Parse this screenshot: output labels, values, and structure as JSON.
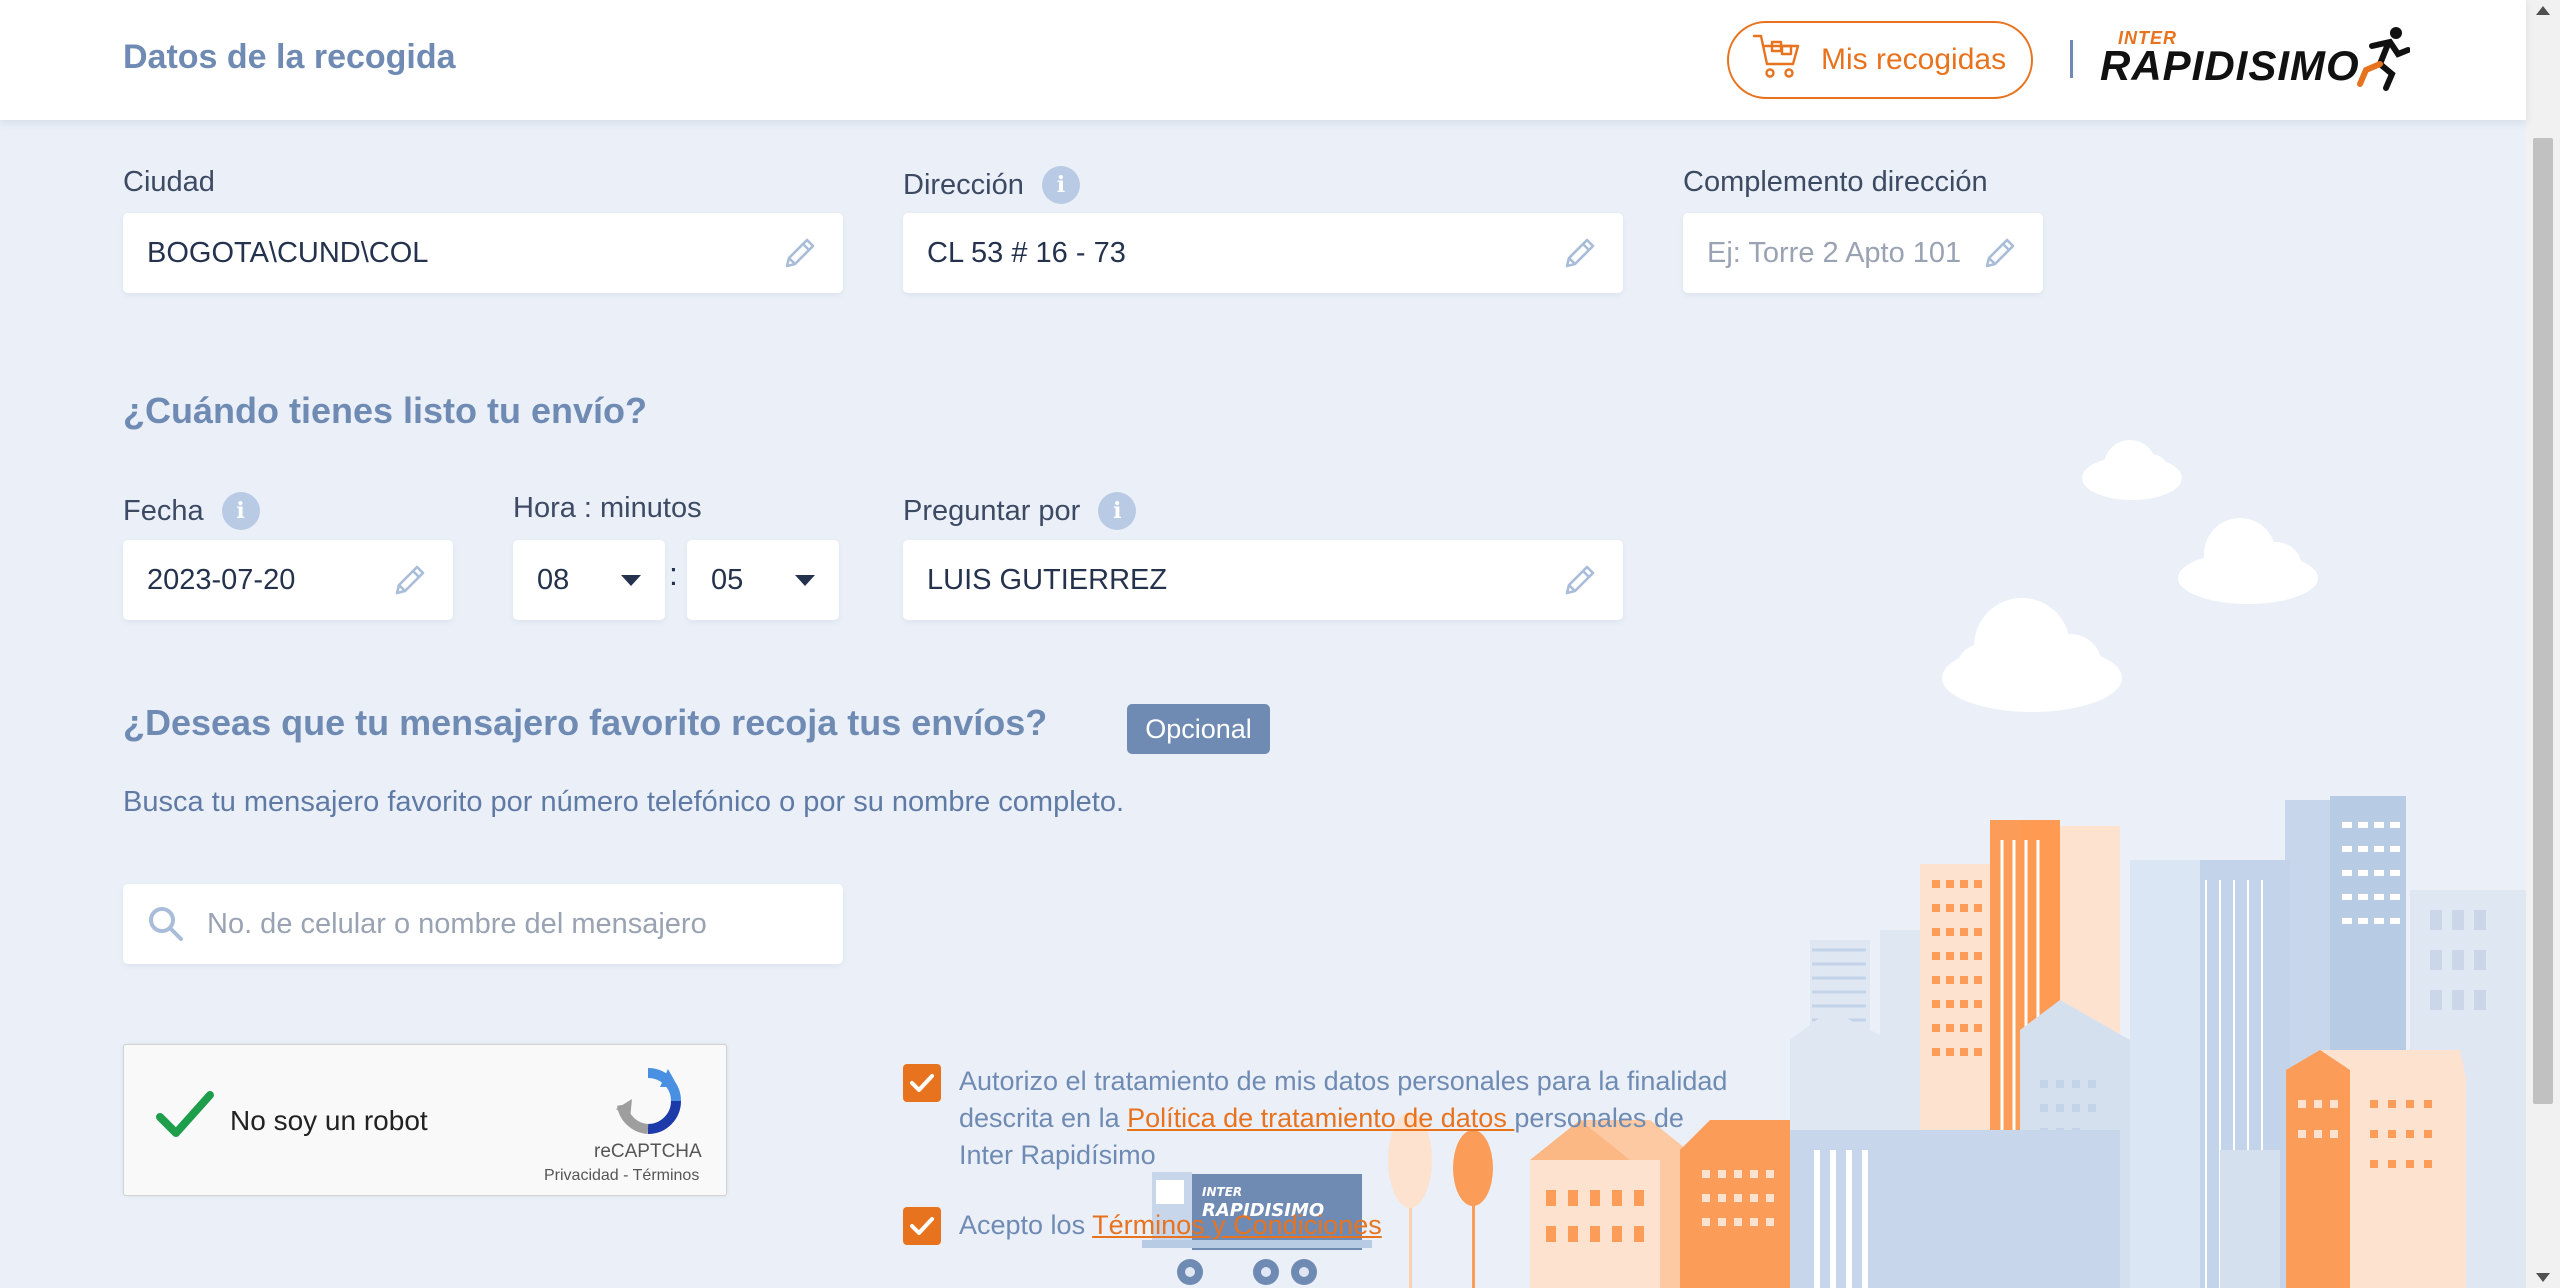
{
  "header": {
    "title": "Datos de la recogida",
    "mis_recogidas_label": "Mis recogidas",
    "logo_small": "INTER",
    "logo_main": "RAPIDISIMO"
  },
  "address": {
    "ciudad_label": "Ciudad",
    "ciudad_value": "BOGOTA\\CUND\\COL",
    "direccion_label": "Dirección",
    "direccion_value": "CL 53 # 16 - 73",
    "complemento_label": "Complemento dirección",
    "complemento_placeholder": "Ej: Torre 2 Apto 101"
  },
  "schedule": {
    "section_title": "¿Cuándo tienes listo tu envío?",
    "fecha_label": "Fecha",
    "fecha_value": "2023-07-20",
    "hora_label": "Hora : minutos",
    "hora_value": "08",
    "minutos_value": "05",
    "colon": ":",
    "preguntar_label": "Preguntar por",
    "preguntar_value": "LUIS GUTIERREZ"
  },
  "messenger": {
    "section_title": "¿Deseas que tu mensajero favorito recoja tus envíos?",
    "badge": "Opcional",
    "description": "Busca tu mensajero favorito por número telefónico o por su nombre completo.",
    "search_placeholder": "No. de celular o nombre del mensajero"
  },
  "captcha": {
    "label": "No soy un robot",
    "brand": "reCAPTCHA",
    "privacy": "Privacidad",
    "separator": " - ",
    "terms": "Términos",
    "checked": true
  },
  "consents": {
    "data_text_1": "Autorizo el tratamiento de mis datos personales para la finalidad",
    "data_text_2": "descrita en la ",
    "data_link": "Política de tratamiento de datos ",
    "data_text_3": "personales de",
    "data_text_4": "Inter Rapidísimo",
    "data_checked": true,
    "terms_text": "Acepto los ",
    "terms_link": "Términos y Condiciones",
    "terms_checked": true
  },
  "colors": {
    "accent": "#e8731f",
    "primary": "#6f8bb3",
    "background": "#ebf0f8"
  },
  "icons": [
    "cart-icon",
    "pencil-icon",
    "info-icon",
    "search-icon",
    "checkmark-icon",
    "recaptcha-icon",
    "chevron-down-icon"
  ]
}
